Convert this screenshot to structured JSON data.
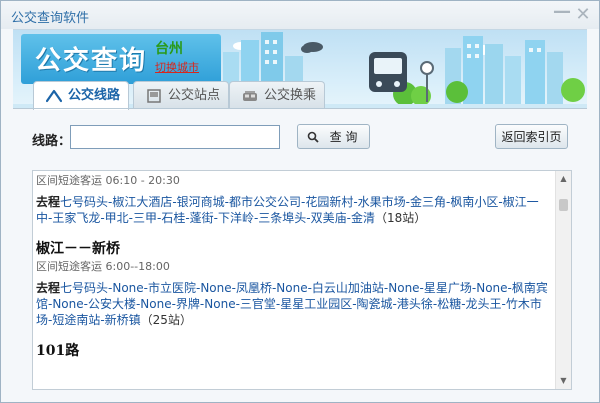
{
  "window": {
    "title": "公交查询软件",
    "minimize_glyph": "—",
    "close_glyph": "✕"
  },
  "banner": {
    "title": "公交查询",
    "city": "台州",
    "switch_city": "切换城市"
  },
  "tabs": [
    {
      "label": "公交线路",
      "icon": "bus-line-icon",
      "active": true
    },
    {
      "label": "公交站点",
      "icon": "bus-stop-icon",
      "active": false
    },
    {
      "label": "公交换乘",
      "icon": "bus-transfer-icon",
      "active": false
    }
  ],
  "search": {
    "label": "线路：",
    "value": "",
    "query_button": "查 询",
    "back_button": "返回索引页"
  },
  "results": [
    {
      "name": "",
      "meta": "区间短途客运  06:10 - 20:30",
      "direction": "去程",
      "stops": "七号码头-椒江大酒店-银河商城-都市公交公司-花园新村-水果市场-金三角-枫南小区-椒江一中-王家飞龙-甲北-三甲-石桂-蓬街-下洋岭-三条埠头-双美庙-金清",
      "count": "（18站）"
    },
    {
      "name": "椒江－－新桥",
      "meta": "区间短途客运  6:00--18:00",
      "direction": "去程",
      "stops": "七号码头-None-市立医院-None-凤凰桥-None-白云山加油站-None-星星广场-None-枫南宾馆-None-公安大楼-None-界牌-None-三官堂-星星工业园区-陶瓷城-港头徐-松糖-龙头王-竹木市场-短途南站-新桥镇",
      "count": "（25站）"
    },
    {
      "name": "101路",
      "meta": "",
      "direction": "",
      "stops": "",
      "count": ""
    }
  ],
  "colors": {
    "accent": "#1b64a8",
    "stop_link": "#1a56a0",
    "city": "#2a9a1a",
    "switch_city": "#d8261c"
  }
}
